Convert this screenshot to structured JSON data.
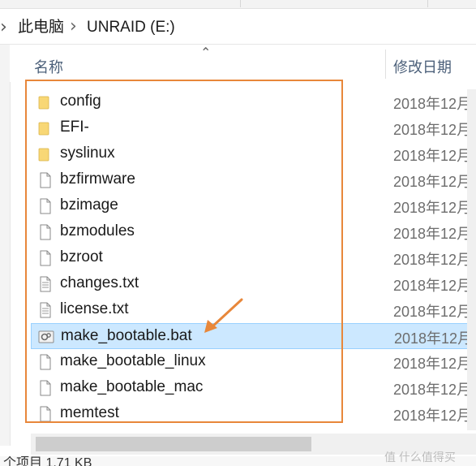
{
  "breadcrumb": {
    "root": "此电脑",
    "drive": "UNRAID (E:)"
  },
  "columns": {
    "name": "名称",
    "date_modified": "修改日期"
  },
  "files": [
    {
      "name": "config",
      "type": "folder",
      "date": "2018年12月",
      "selected": false
    },
    {
      "name": "EFI-",
      "type": "folder",
      "date": "2018年12月",
      "selected": false
    },
    {
      "name": "syslinux",
      "type": "folder",
      "date": "2018年12月",
      "selected": false
    },
    {
      "name": "bzfirmware",
      "type": "file",
      "date": "2018年12月",
      "selected": false
    },
    {
      "name": "bzimage",
      "type": "file",
      "date": "2018年12月",
      "selected": false
    },
    {
      "name": "bzmodules",
      "type": "file",
      "date": "2018年12月",
      "selected": false
    },
    {
      "name": "bzroot",
      "type": "file",
      "date": "2018年12月",
      "selected": false
    },
    {
      "name": "changes.txt",
      "type": "text",
      "date": "2018年12月",
      "selected": false
    },
    {
      "name": "license.txt",
      "type": "text",
      "date": "2018年12月",
      "selected": false
    },
    {
      "name": "make_bootable.bat",
      "type": "batch",
      "date": "2018年12月",
      "selected": true
    },
    {
      "name": "make_bootable_linux",
      "type": "file",
      "date": "2018年12月",
      "selected": false
    },
    {
      "name": "make_bootable_mac",
      "type": "file",
      "date": "2018年12月",
      "selected": false
    },
    {
      "name": "memtest",
      "type": "file",
      "date": "2018年12月",
      "selected": false
    }
  ],
  "status": {
    "text": "个项目 1.71 KB"
  },
  "watermark": "值 什么值得买",
  "colors": {
    "selection": "#cce8ff",
    "annotation": "#e8873a",
    "folder": "#f8d775"
  }
}
